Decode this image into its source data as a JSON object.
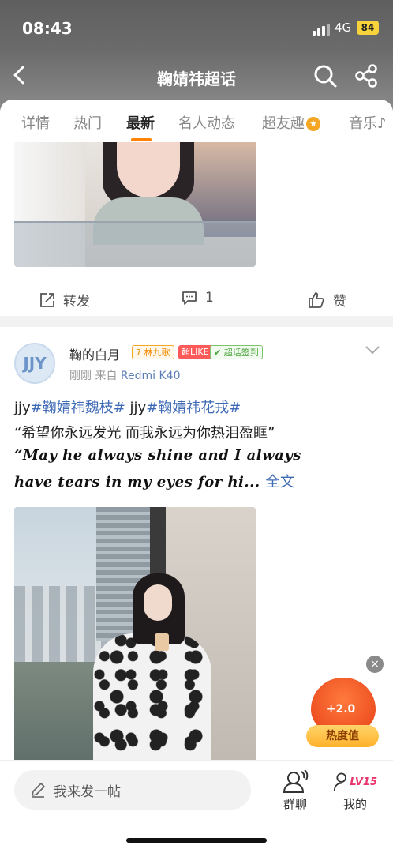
{
  "status": {
    "time": "08:43",
    "network": "4G",
    "battery": "84"
  },
  "header": {
    "title": "鞠婧祎超话"
  },
  "tabs": [
    {
      "label": "详情"
    },
    {
      "label": "热门"
    },
    {
      "label": "最新"
    },
    {
      "label": "名人动态"
    },
    {
      "label": "超友趣"
    },
    {
      "label": "音乐"
    }
  ],
  "active_tab": "最新",
  "post1": {
    "repost_label": "转发",
    "comment_count": "1",
    "like_label": "赞"
  },
  "post2": {
    "avatar_text": "JJY",
    "username": "鞠的白月",
    "badge_level": "7",
    "badge_name": "林九歌",
    "badge_super": "超LIKE",
    "badge_sign": "超话签到",
    "time": "刚刚",
    "source_prefix": "来自",
    "device": "Redmi K40",
    "line1_a": "jjy",
    "tag1": "#鞠婧祎魏枝#",
    "line1_b": " jjy",
    "tag2": "#鞠婧祎花戎#",
    "line2": "“希望你永远发光 而我永远为你热泪盈眶”",
    "line3": "“May he always shine and I always",
    "line4": "have tears in my eyes for hi...",
    "full_text": "全文"
  },
  "float_badge": {
    "plus": "+2.0",
    "label": "热度值",
    "close": "×"
  },
  "bottom": {
    "compose_placeholder": "我来发一帖",
    "group_chat": "群聊",
    "mine": "我的",
    "level": "LV15"
  },
  "icons": [
    "back-icon",
    "search-icon",
    "share-icon",
    "star-badge-icon",
    "repost-icon",
    "comment-icon",
    "like-icon",
    "chevron-down-icon",
    "pencil-icon",
    "group-chat-icon",
    "profile-icon"
  ],
  "colors": {
    "accent": "#ff8200",
    "link": "#3f6ab6",
    "header_bg": "#6b6b6b"
  }
}
